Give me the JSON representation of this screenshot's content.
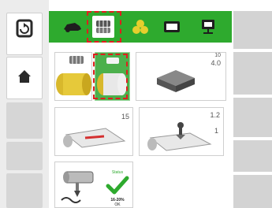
{
  "toolbar": {
    "tabs": [
      {
        "icon": "tractor-icon"
      },
      {
        "icon": "bale-count-icon",
        "selected": true
      },
      {
        "icon": "bales-stack-icon"
      },
      {
        "icon": "screen-icon"
      },
      {
        "icon": "network-display-icon"
      }
    ]
  },
  "sidebar": {
    "items": [
      {
        "icon": "refresh-icon"
      },
      {
        "icon": "home-icon"
      }
    ]
  },
  "tiles": {
    "bale_density": {
      "value": "4.0",
      "unit_label": "10"
    },
    "net_wrap": {
      "value": "15"
    },
    "knife_pressure": {
      "value_top": "1.2",
      "value_bottom": "1"
    },
    "status": {
      "label_top": "Status",
      "label_bottom": "16-20%",
      "label_small": "OK"
    }
  },
  "colors": {
    "accent": "#2eaa2e",
    "highlight": "#e01e1e",
    "bale": "#d8b82c"
  }
}
